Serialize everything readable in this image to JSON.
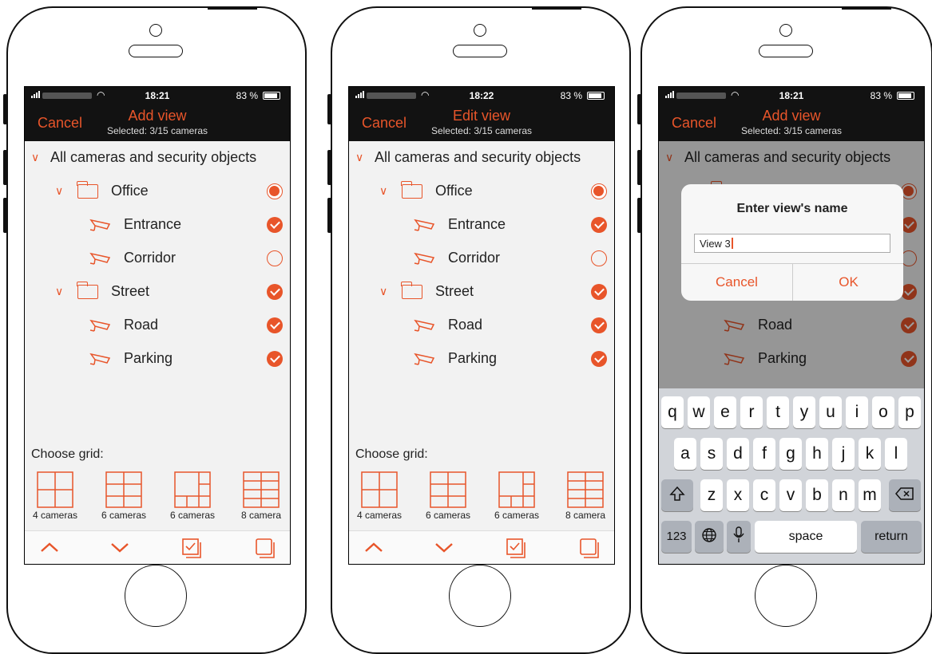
{
  "colors": {
    "accent": "#e8552a",
    "header_bg": "#121212",
    "screen_bg": "#f2f2f2"
  },
  "phones": [
    {
      "status": {
        "time": "18:21",
        "battery": "83 %"
      },
      "nav": {
        "cancel": "Cancel",
        "title": "Add view",
        "subtitle": "Selected: 3/15 cameras"
      }
    },
    {
      "status": {
        "time": "18:22",
        "battery": "83 %"
      },
      "nav": {
        "cancel": "Cancel",
        "title": "Edit view",
        "subtitle": "Selected: 3/15 cameras"
      }
    },
    {
      "status": {
        "time": "18:21",
        "battery": "83 %"
      },
      "nav": {
        "cancel": "Cancel",
        "title": "Add view",
        "subtitle": "Selected: 3/15 cameras"
      }
    }
  ],
  "tree": {
    "root": "All cameras and security objects",
    "groups": [
      {
        "name": "Office",
        "state": "partial",
        "cameras": [
          {
            "name": "Entrance",
            "state": "checked"
          },
          {
            "name": "Corridor",
            "state": "unchecked"
          }
        ]
      },
      {
        "name": "Street",
        "state": "checked",
        "cameras": [
          {
            "name": "Road",
            "state": "checked"
          },
          {
            "name": "Parking",
            "state": "checked"
          }
        ]
      }
    ]
  },
  "grid": {
    "label": "Choose grid:",
    "options": [
      "4 cameras",
      "6 cameras",
      "6 cameras",
      "8 camera"
    ]
  },
  "toolbar": {
    "icons": [
      "chevron-up-icon",
      "chevron-down-icon",
      "check-all-icon",
      "copy-icon"
    ]
  },
  "dialog": {
    "title": "Enter view's name",
    "value": "View 3",
    "cancel": "Cancel",
    "ok": "OK"
  },
  "keyboard": {
    "row1": [
      "q",
      "w",
      "e",
      "r",
      "t",
      "y",
      "u",
      "i",
      "o",
      "p"
    ],
    "row2": [
      "a",
      "s",
      "d",
      "f",
      "g",
      "h",
      "j",
      "k",
      "l"
    ],
    "row3": [
      "z",
      "x",
      "c",
      "v",
      "b",
      "n",
      "m"
    ],
    "numbers": "123",
    "space": "space",
    "return": "return"
  }
}
